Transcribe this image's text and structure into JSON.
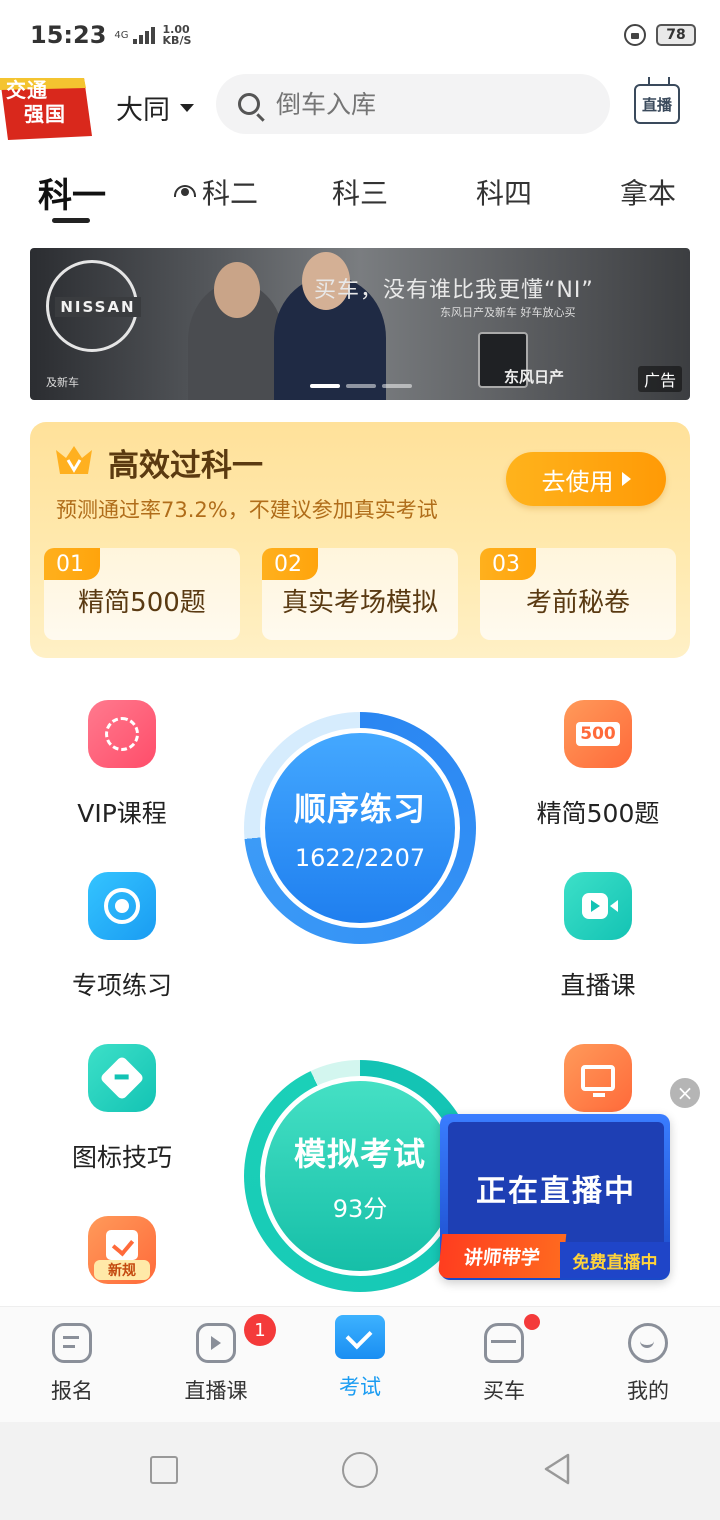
{
  "status_bar": {
    "time": "15:23",
    "network": "4G",
    "speed_value": "1.00",
    "speed_unit": "KB/S",
    "battery": "78"
  },
  "header": {
    "logo_line1": "交通",
    "logo_line2": "强国",
    "city": "大同",
    "search_placeholder": "倒车入库",
    "live_label": "直播"
  },
  "subject_tabs": [
    {
      "label": "科一",
      "active": true
    },
    {
      "label": "科二",
      "active": false
    },
    {
      "label": "科三",
      "active": false
    },
    {
      "label": "科四",
      "active": false
    },
    {
      "label": "拿本",
      "active": false
    }
  ],
  "banner": {
    "brand": "NISSAN",
    "slogan": "买车，没有谁比我更懂“NI”",
    "subline": "东风日产及新车  好车放心买",
    "small_text": "及新车",
    "dealer": "东风日产",
    "ad_label": "广告",
    "slide_count": 3,
    "active_slide": 1
  },
  "promo": {
    "title": "高效过科一",
    "description": "预测通过率73.2%，不建议参加真实考试",
    "button_label": "去使用",
    "items": [
      {
        "num": "01",
        "label": "精简500题"
      },
      {
        "num": "02",
        "label": "真实考场模拟"
      },
      {
        "num": "03",
        "label": "考前秘卷"
      }
    ]
  },
  "features": {
    "vip": "VIP课程",
    "jingjian": "精简500题",
    "jingjian_icon_text": "500",
    "special": "专项练习",
    "live_course": "直播课",
    "sign_tips": "图标技巧",
    "new_rules_tag": "新规"
  },
  "sequential_practice": {
    "title": "顺序练习",
    "progress_text": "1622/2207",
    "done": 1622,
    "total": 2207
  },
  "mock_exam": {
    "title": "模拟考试",
    "score_text": "93分",
    "score": 93
  },
  "live_float": {
    "screen_text": "正在直播中",
    "tag1": "讲师带学",
    "tag2": "免费直播中",
    "close": "×"
  },
  "bottom_nav": [
    {
      "label": "报名",
      "icon": "form-icon"
    },
    {
      "label": "直播课",
      "icon": "tv-icon",
      "badge": "1"
    },
    {
      "label": "考试",
      "icon": "exam-icon",
      "active": true
    },
    {
      "label": "买车",
      "icon": "car-icon",
      "dot": true
    },
    {
      "label": "我的",
      "icon": "profile-icon"
    }
  ],
  "colors": {
    "accent_blue": "#1a9cf2",
    "promo_orange": "#ffa40c",
    "badge_red": "#f43a3a",
    "mock_green": "#13c3b4"
  }
}
